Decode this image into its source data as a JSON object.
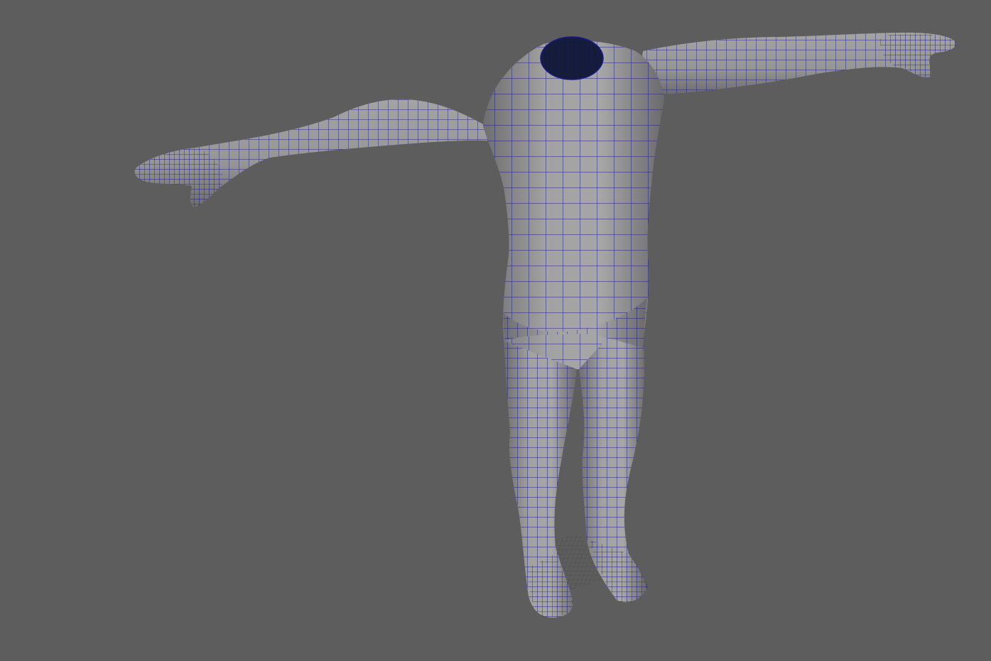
{
  "viewport": {
    "view": "perspective",
    "background_color": "#5d5d5d",
    "display_mode": "smooth-shade-with-wireframe-on-shaded"
  },
  "mesh": {
    "object": "headless-humanoid-body",
    "pose": "T-pose",
    "surface_color": "#9c9c9c",
    "wireframe_color": "#1a1a8c",
    "neck_opening_color": "#141c3a"
  },
  "ground_grid": {
    "visible": true,
    "color": "#474747"
  }
}
